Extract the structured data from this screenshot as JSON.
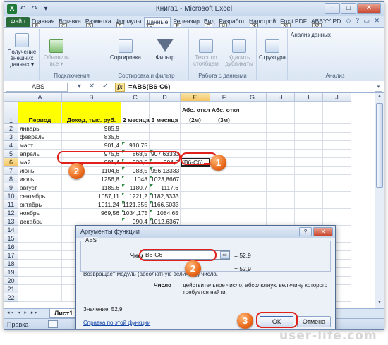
{
  "window": {
    "title": "Книга1 - Microsoft Excel",
    "app_icon_letter": "X",
    "qat": "↶ ↷ ▾",
    "buttons": [
      "–",
      "□",
      "✕"
    ]
  },
  "ribbon_tabs": {
    "file": "Файл",
    "tabs": [
      {
        "label": "Главная",
        "key": "Я"
      },
      {
        "label": "Вставка",
        "key": "С"
      },
      {
        "label": "Разметка",
        "key": "З"
      },
      {
        "label": "Формулы",
        "key": "Л"
      },
      {
        "label": "Данные",
        "key": "Ё"
      },
      {
        "label": "Рецензир",
        "key": "Р"
      },
      {
        "label": "Вид",
        "key": "О"
      },
      {
        "label": "Разработ",
        "key": "Ч"
      },
      {
        "label": "Надстрой",
        "key": "Ж"
      },
      {
        "label": "Foxit PDF",
        "key": "31"
      },
      {
        "label": "ABBYY PD",
        "key": "32"
      }
    ],
    "right_icons": "◇ ? ▭ ✕"
  },
  "ribbon": {
    "groups": [
      {
        "label": ""
      },
      {
        "label": "Подключения"
      },
      {
        "label": "Сортировка и фильтр"
      },
      {
        "label": "Работа с данными"
      },
      {
        "label": "Анализ"
      }
    ],
    "buttons": {
      "get_external": "Получение внешних данных ▾",
      "refresh": "Обновить все ▾",
      "sort": "Сортировка",
      "filter": "Фильтр",
      "text_to_cols": "Текст по столбцам",
      "remove_dups": "Удалить дубликаты",
      "structure": "Структура",
      "data_analysis": "Анализ данных"
    }
  },
  "formula_bar": {
    "name_box": "ABS",
    "buttons": "▾ ✕ ✓",
    "fx": "fx",
    "formula": "=ABS(B6-C6)"
  },
  "sheet": {
    "columns": [
      "A",
      "B",
      "C",
      "D",
      "E",
      "F",
      "G",
      "H",
      "I",
      "J"
    ],
    "rows": [
      "1",
      "2",
      "3",
      "4",
      "5",
      "6",
      "7",
      "8",
      "9",
      "10",
      "11",
      "12",
      "13",
      "14",
      "15",
      "16",
      "17",
      "18",
      "19",
      "20",
      "21",
      "22"
    ],
    "headers": {
      "a1": "Период",
      "b1": "Доход, тыс. руб.",
      "c1": "2 месяца",
      "d1": "3 месяца",
      "e1_line1": "Абс. откл",
      "e1_line2": "(2м)",
      "f1_line1": "Абс. откл",
      "f1_line2": "(3м)"
    },
    "data": [
      {
        "period": "январь",
        "income": "985,9",
        "m2": "",
        "m3": ""
      },
      {
        "period": "февраль",
        "income": "835,6",
        "m2": "",
        "m3": ""
      },
      {
        "period": "март",
        "income": "901,4",
        "m2": "910,75",
        "m3": ""
      },
      {
        "period": "апрель",
        "income": "975,6",
        "m2": "868,5",
        "m3": "907,63333"
      },
      {
        "period": "май",
        "income": "991,4",
        "m2": "938,5",
        "m3": "904,2"
      },
      {
        "period": "июнь",
        "income": "1104,6",
        "m2": "983,5",
        "m3": "956,13333"
      },
      {
        "period": "июль",
        "income": "1256,8",
        "m2": "1048",
        "m3": "1023,8667"
      },
      {
        "period": "август",
        "income": "1185,6",
        "m2": "1180,7",
        "m3": "1117,6"
      },
      {
        "period": "сентябрь",
        "income": "1057,11",
        "m2": "1221,2",
        "m3": "1182,3333"
      },
      {
        "period": "октябрь",
        "income": "1011,24",
        "m2": "1121,355",
        "m3": "1166,5033"
      },
      {
        "period": "ноябрь",
        "income": "969,56",
        "m2": "1034,175",
        "m3": "1084,65"
      },
      {
        "period": "декабрь",
        "income": "",
        "m2": "990,4",
        "m3": "1012,6367"
      }
    ],
    "active_cell_text": "(B6-C6)",
    "sheet_tab": "Лист1",
    "nav": "◂◂ ◂ ▸ ▸▸"
  },
  "status": {
    "mode": "Правка"
  },
  "dialog": {
    "title": "Аргументы функции",
    "buttons": [
      "?",
      "✕"
    ],
    "function_name": "ABS",
    "arg_label": "Число",
    "arg_value": "B6-C6",
    "arg_result": "=  52,9",
    "result_line": "=  52,9",
    "description": "Возвращает модуль (абсолютную величину) числа.",
    "param_name": "Число",
    "param_desc": "действительное число, абсолютную величину которого требуется найти.",
    "value_line": "Значение:  52,9",
    "help_link": "Справка по этой функции",
    "ok": "ОК",
    "cancel": "Отмена"
  },
  "callouts": [
    "1",
    "2",
    "2",
    "3"
  ],
  "watermark": "user-life.com",
  "colors": {
    "header_fill": "#ffff00",
    "callout_ring": "#e0201b",
    "callout_badge": "#ea6a1c",
    "file_tab": "#2a6b3a"
  }
}
